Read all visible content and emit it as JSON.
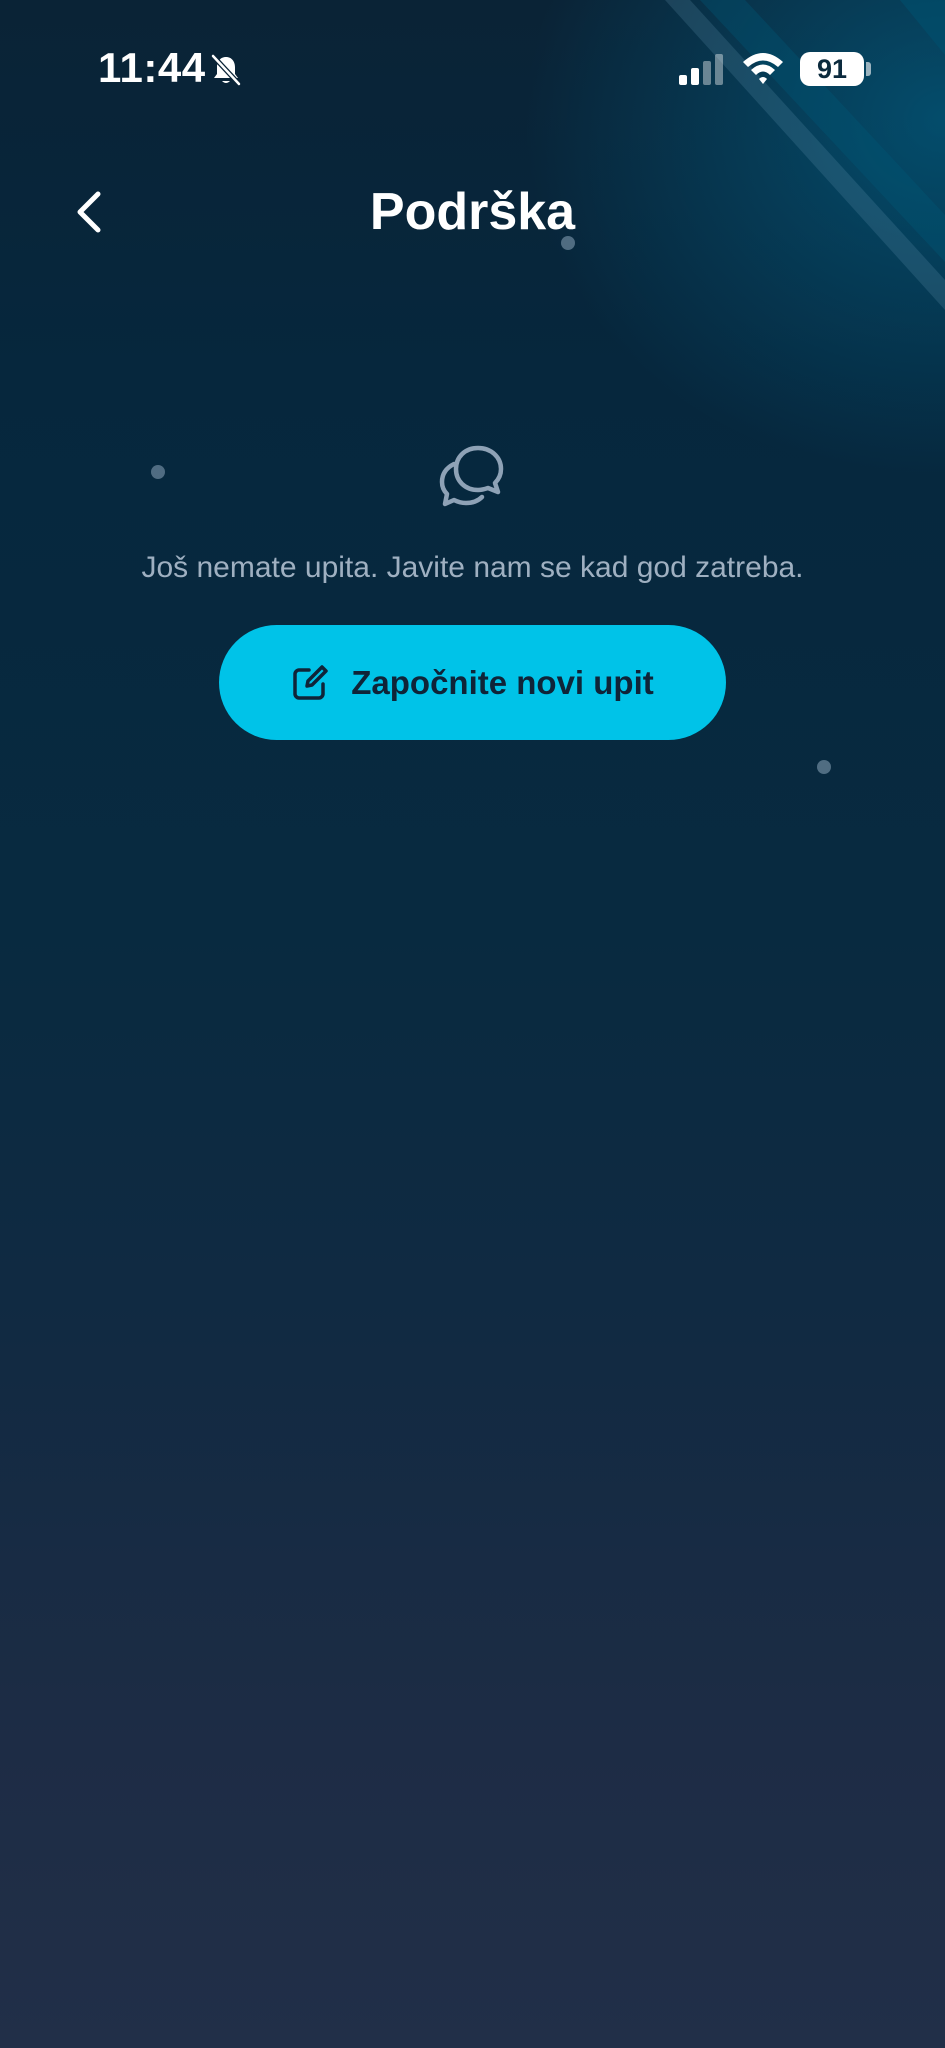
{
  "status_bar": {
    "time": "11:44",
    "battery": "91",
    "icons": [
      "bell-slash-icon",
      "cellular-signal-icon",
      "wifi-icon",
      "battery-icon"
    ]
  },
  "header": {
    "title": "Podrška",
    "back_icon": "chevron-left-icon"
  },
  "empty_state": {
    "icon": "chat-bubbles-icon",
    "message": "Još nemate upita. Javite nam se kad god zatreba.",
    "button_label": "Započnite novi upit",
    "button_icon": "edit-icon"
  },
  "colors": {
    "accent": "#00c3e8",
    "background_top": "#0a2336",
    "background_bottom": "#212f48",
    "text_muted": "#9fb0c1"
  }
}
